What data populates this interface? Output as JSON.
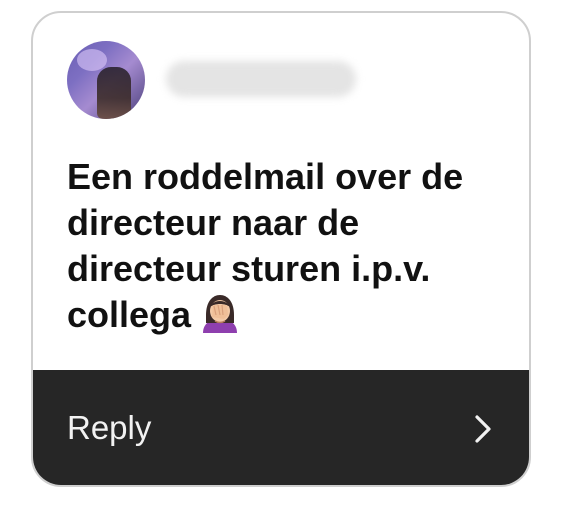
{
  "header": {
    "username": "instagramuser",
    "avatar_icon": "profile-photo"
  },
  "message": {
    "text": "Een roddelmail over de directeur naar de directeur sturen i.p.v. collega",
    "emoji_icon": "woman-facepalming"
  },
  "footer": {
    "reply_label": "Reply",
    "chevron_icon": "chevron-right-icon"
  },
  "colors": {
    "card_border": "#cfcfcf",
    "footer_bg": "#262626",
    "message_text": "#111111",
    "reply_text": "#f2f2f2"
  }
}
